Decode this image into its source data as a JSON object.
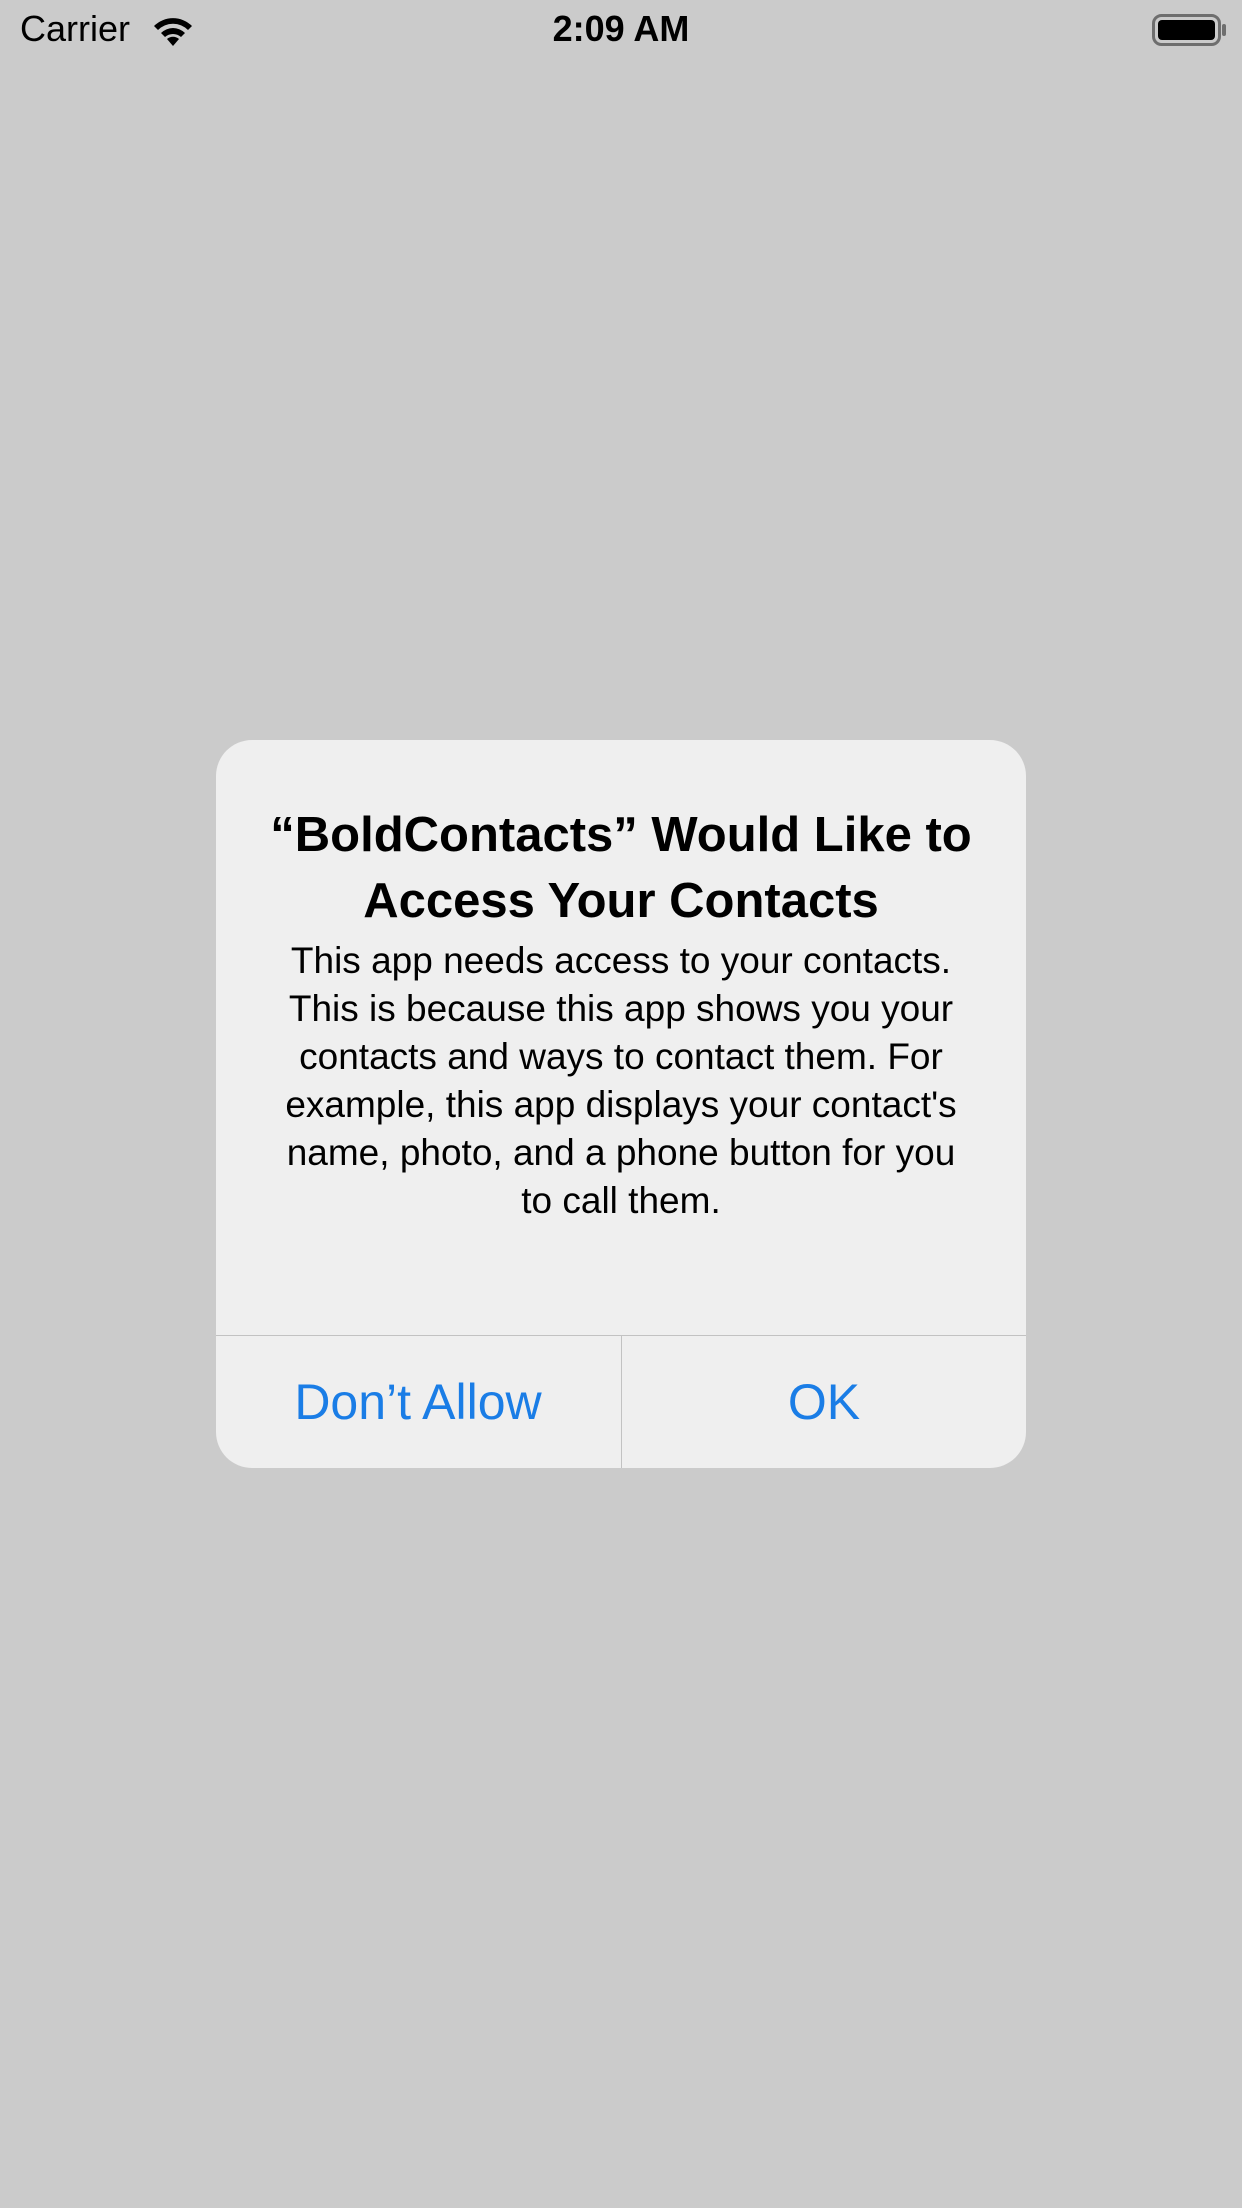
{
  "status_bar": {
    "carrier": "Carrier",
    "time": "2:09 AM",
    "wifi_icon": "wifi-icon",
    "battery_icon": "battery-icon"
  },
  "alert": {
    "title": "“BoldContacts” Would Like to Access Your Contacts",
    "message": "This app needs access to your contacts. This is because this app shows you your contacts and ways to contact them. For example, this app displays your contact's name, photo, and a phone button for you to call them.",
    "buttons": {
      "deny_label": "Don’t Allow",
      "ok_label": "OK"
    },
    "accent_color": "#1a7de6"
  },
  "colors": {
    "background": "#cbcbcb",
    "alert_background": "#efefef"
  }
}
